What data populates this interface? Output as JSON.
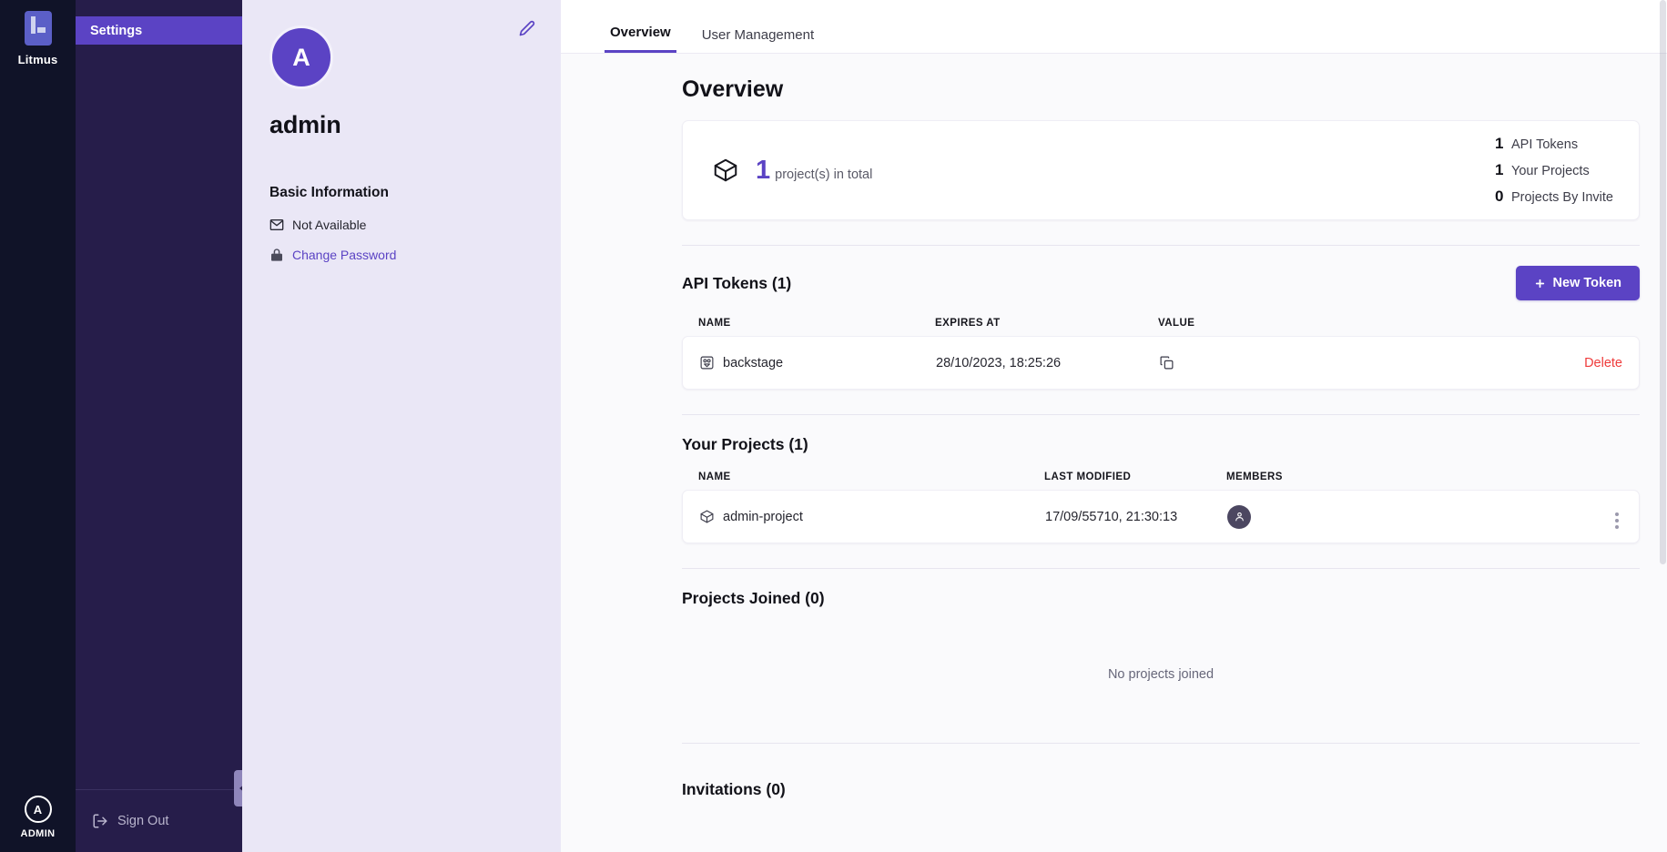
{
  "rail": {
    "logo_icon": "litmus-book-icon",
    "logo_label": "Litmus",
    "user_initial": "A",
    "user_role_label": "ADMIN"
  },
  "nav": {
    "items": [
      {
        "label": "Settings",
        "active": true
      }
    ],
    "signout_label": "Sign Out",
    "signout_icon": "sign-out-icon",
    "collapse_icon": "chevron-left-icon"
  },
  "profile": {
    "edit_icon": "pencil-icon",
    "avatar_initial": "A",
    "username": "admin",
    "basic_information_title": "Basic Information",
    "email_icon": "envelope-icon",
    "email_value": "Not Available",
    "lock_icon": "lock-icon",
    "change_password_label": "Change Password"
  },
  "tabs": [
    {
      "label": "Overview",
      "active": true
    },
    {
      "label": "User Management",
      "active": false
    }
  ],
  "page": {
    "title": "Overview"
  },
  "summary": {
    "project_icon": "cube-icon",
    "project_count": "1",
    "project_text": "project(s) in total",
    "stats": [
      {
        "value": "1",
        "label": "API Tokens"
      },
      {
        "value": "1",
        "label": "Your Projects"
      },
      {
        "value": "0",
        "label": "Projects By Invite"
      }
    ]
  },
  "api_tokens": {
    "section_title": "API Tokens (1)",
    "new_token_button": "New Token",
    "new_token_icon": "plus-icon",
    "columns": [
      "NAME",
      "EXPIRES AT",
      "VALUE"
    ],
    "rows": [
      {
        "name_icon": "token-icon",
        "name": "backstage",
        "expires_at": "28/10/2023, 18:25:26",
        "value_icon": "copy-icon",
        "action_label": "Delete"
      }
    ]
  },
  "your_projects": {
    "section_title": "Your Projects (1)",
    "columns": [
      "NAME",
      "LAST MODIFIED",
      "MEMBERS"
    ],
    "rows": [
      {
        "name_icon": "cube-icon",
        "name": "admin-project",
        "last_modified": "17/09/55710, 21:30:13",
        "member_icon": "user-icon",
        "menu_icon": "kebab-menu-icon"
      }
    ]
  },
  "projects_joined": {
    "section_title": "Projects Joined (0)",
    "empty_text": "No projects joined"
  },
  "invitations": {
    "section_title": "Invitations (0)"
  },
  "colors": {
    "brand_purple": "#5b43c4",
    "nav_dark": "#261d4a",
    "rail_dark": "#101328",
    "profile_bg": "#eae7f6",
    "danger_red": "#ef3b3b"
  }
}
